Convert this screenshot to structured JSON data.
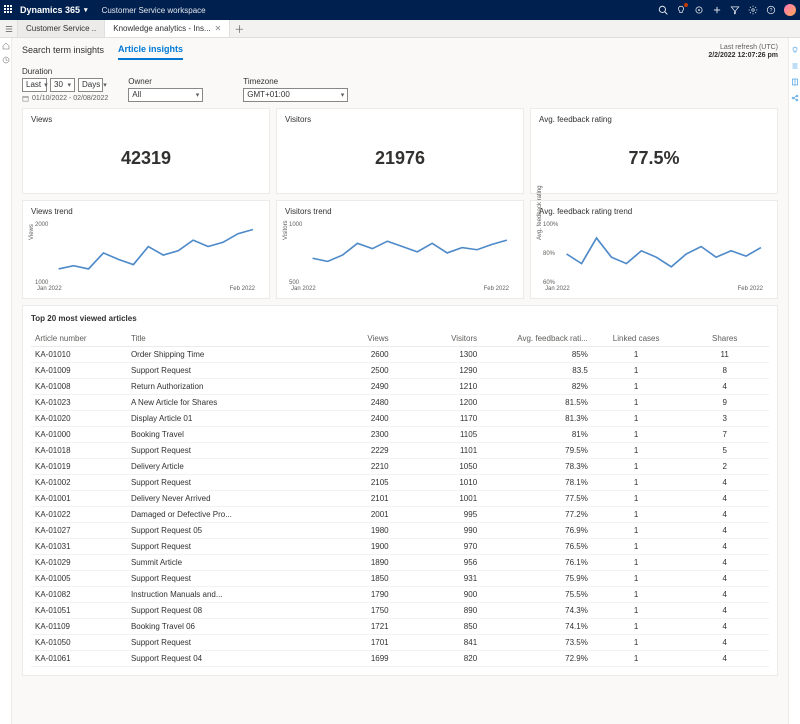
{
  "topbar": {
    "brand": "Dynamics 365",
    "workspace": "Customer Service workspace"
  },
  "tabs": {
    "tab1": "Customer Service ..",
    "tab2": "Knowledge analytics - Ins..."
  },
  "inner_tabs": {
    "search": "Search term insights",
    "article": "Article insights"
  },
  "refresh": {
    "label": "Last refresh (UTC)",
    "value": "2/2/2022 12:07:26 pm"
  },
  "filters": {
    "duration_label": "Duration",
    "duration_val": "Last",
    "duration_num": "30",
    "duration_unit": "Days",
    "date_range": "01/10/2022 - 02/08/2022",
    "owner_label": "Owner",
    "owner_val": "All",
    "timezone_label": "Timezone",
    "timezone_val": "GMT+01:00"
  },
  "cards": {
    "views_title": "Views",
    "views_value": "42319",
    "visitors_title": "Visitors",
    "visitors_value": "21976",
    "rating_title": "Avg. feedback rating",
    "rating_value": "77.5%",
    "views_trend_title": "Views trend",
    "visitors_trend_title": "Visitors trend",
    "rating_trend_title": "Avg. feedback rating trend",
    "x_jan": "Jan 2022",
    "x_feb": "Feb 2022",
    "y_views_ax": "Views",
    "y_visitors_ax": "Visitors",
    "y_rating_ax": "Avg. feedback rating"
  },
  "chart_data": [
    {
      "type": "line",
      "title": "Views trend",
      "xlabel": "",
      "ylabel": "Views",
      "ylim": [
        1000,
        2000
      ],
      "x_tick_labels": [
        "Jan 2022",
        "Feb 2022"
      ],
      "y_tick_labels": [
        "1000",
        "2000"
      ],
      "series": [
        {
          "name": "Views",
          "values": [
            1270,
            1320,
            1270,
            1515,
            1420,
            1340,
            1625,
            1480,
            1550,
            1720,
            1610,
            1690,
            1820,
            1890
          ]
        }
      ]
    },
    {
      "type": "line",
      "title": "Visitors trend",
      "xlabel": "",
      "ylabel": "Visitors",
      "ylim": [
        500,
        1000
      ],
      "x_tick_labels": [
        "Jan 2022",
        "Feb 2022"
      ],
      "y_tick_labels": [
        "500",
        "1000"
      ],
      "series": [
        {
          "name": "Visitors",
          "values": [
            720,
            690,
            745,
            830,
            795,
            850,
            810,
            770,
            830,
            760,
            800,
            785,
            825,
            855
          ]
        }
      ]
    },
    {
      "type": "line",
      "title": "Avg. feedback rating trend",
      "xlabel": "",
      "ylabel": "Avg. feedback rating",
      "ylim": [
        60,
        100
      ],
      "x_tick_labels": [
        "Jan 2022",
        "Feb 2022"
      ],
      "y_tick_labels": [
        "60%",
        "80%",
        "100%"
      ],
      "series": [
        {
          "name": "Rating",
          "values": [
            80,
            74,
            90,
            78,
            74,
            82,
            78,
            72,
            80,
            85,
            78,
            82,
            79,
            84
          ]
        }
      ]
    }
  ],
  "table": {
    "title": "Top 20 most viewed articles",
    "headers": {
      "article": "Article number",
      "title": "Title",
      "views": "Views",
      "visitors": "Visitors",
      "rating": "Avg. feedback rati...",
      "linked": "Linked cases",
      "shares": "Shares"
    },
    "rows": [
      {
        "a": "KA-01010",
        "t": "Order Shipping Time",
        "v": "2600",
        "vis": "1300",
        "r": "85%",
        "l": "1",
        "s": "11"
      },
      {
        "a": "KA-01009",
        "t": "Support Request",
        "v": "2500",
        "vis": "1290",
        "r": "83.5",
        "l": "1",
        "s": "8"
      },
      {
        "a": "KA-01008",
        "t": "Return Authorization",
        "v": "2490",
        "vis": "1210",
        "r": "82%",
        "l": "1",
        "s": "4"
      },
      {
        "a": "KA-01023",
        "t": "A New Article for Shares",
        "v": "2480",
        "vis": "1200",
        "r": "81.5%",
        "l": "1",
        "s": "9"
      },
      {
        "a": "KA-01020",
        "t": "Display Article 01",
        "v": "2400",
        "vis": "1170",
        "r": "81.3%",
        "l": "1",
        "s": "3"
      },
      {
        "a": "KA-01000",
        "t": "Booking Travel",
        "v": "2300",
        "vis": "1105",
        "r": "81%",
        "l": "1",
        "s": "7"
      },
      {
        "a": "KA-01018",
        "t": "Support Request",
        "v": "2229",
        "vis": "1101",
        "r": "79.5%",
        "l": "1",
        "s": "5"
      },
      {
        "a": "KA-01019",
        "t": "Delivery Article",
        "v": "2210",
        "vis": "1050",
        "r": "78.3%",
        "l": "1",
        "s": "2"
      },
      {
        "a": "KA-01002",
        "t": "Support Request",
        "v": "2105",
        "vis": "1010",
        "r": "78.1%",
        "l": "1",
        "s": "4"
      },
      {
        "a": "KA-01001",
        "t": "Delivery Never Arrived",
        "v": "2101",
        "vis": "1001",
        "r": "77.5%",
        "l": "1",
        "s": "4"
      },
      {
        "a": "KA-01022",
        "t": "Damaged or Defective Pro...",
        "v": "2001",
        "vis": "995",
        "r": "77.2%",
        "l": "1",
        "s": "4"
      },
      {
        "a": "KA-01027",
        "t": "Support Request 05",
        "v": "1980",
        "vis": "990",
        "r": "76.9%",
        "l": "1",
        "s": "4"
      },
      {
        "a": "KA-01031",
        "t": "Support Request",
        "v": "1900",
        "vis": "970",
        "r": "76.5%",
        "l": "1",
        "s": "4"
      },
      {
        "a": "KA-01029",
        "t": "Summit Article",
        "v": "1890",
        "vis": "956",
        "r": "76.1%",
        "l": "1",
        "s": "4"
      },
      {
        "a": "KA-01005",
        "t": "Support Request",
        "v": "1850",
        "vis": "931",
        "r": "75.9%",
        "l": "1",
        "s": "4"
      },
      {
        "a": "KA-01082",
        "t": "Instruction Manuals and...",
        "v": "1790",
        "vis": "900",
        "r": "75.5%",
        "l": "1",
        "s": "4"
      },
      {
        "a": "KA-01051",
        "t": "Support Request 08",
        "v": "1750",
        "vis": "890",
        "r": "74.3%",
        "l": "1",
        "s": "4"
      },
      {
        "a": "KA-01109",
        "t": "Booking Travel 06",
        "v": "1721",
        "vis": "850",
        "r": "74.1%",
        "l": "1",
        "s": "4"
      },
      {
        "a": "KA-01050",
        "t": "Support Request",
        "v": "1701",
        "vis": "841",
        "r": "73.5%",
        "l": "1",
        "s": "4"
      },
      {
        "a": "KA-01061",
        "t": "Support Request 04",
        "v": "1699",
        "vis": "820",
        "r": "72.9%",
        "l": "1",
        "s": "4"
      }
    ]
  }
}
